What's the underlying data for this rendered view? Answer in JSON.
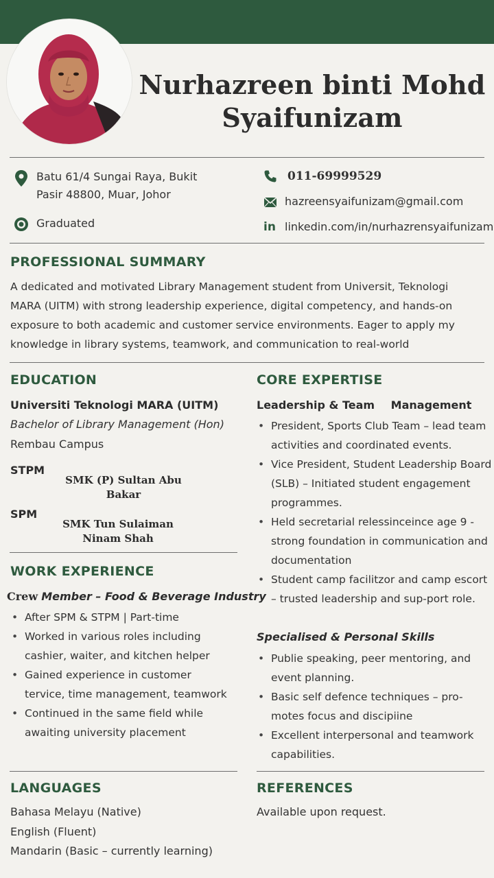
{
  "header": {
    "name_line1": "Nurhazreen binti Mohd",
    "name_line2": "Syaifunizam"
  },
  "contact": {
    "address_line1": "Batu 61/4 Sungai Raya, Bukit",
    "address_line2": "Pasir 48800, Muar, Johor",
    "status": "Graduated",
    "phone": "011-69999529",
    "email": "hazreensyaifunizam@gmail.com",
    "linkedin_label": "in",
    "linkedin": "linkedin.com/in/nurhazrensyaifunizam"
  },
  "summary": {
    "title": "PROFESSIONAL SUMMARY",
    "lines": [
      "A dedicated and motivated Library Management student from Universit, Teknologi",
      "MARA (UITM) with strong leadership experience, digital competency, and hands-on",
      "exposure to both academic and customer service environments. Eager to apply my",
      "knowledge in library systems, teamwork, and communication to real-world"
    ]
  },
  "education": {
    "title": "EDUCATION",
    "university": "Universiti Teknologi MARA (UITM)",
    "degree": "Bachelor of Library Management (Hon)",
    "campus": "Rembau Campus",
    "stpm_label": "STPM",
    "stpm_school_line1": "SMK (P) Sultan Abu",
    "stpm_school_line2": "Bakar",
    "spm_label": "SPM",
    "spm_school_line1": "SMK Tun Sulaiman",
    "spm_school_line2": "Ninam Shah"
  },
  "work": {
    "title": "WORK EXPERIENCE",
    "role_prefix": "Crew",
    "role": "Member – Food & Beverage Industry",
    "items": [
      "After SPM & STPM | Part-time",
      "Worked in various roles including cashier, waiter, and kitchen helper",
      "Gained experience in customer tervice, time management, teamwork",
      "Continued in the same field while awaiting university placement"
    ]
  },
  "expertise": {
    "title": "CORE EXPERTISE",
    "group1_a": "Leadership & Team",
    "group1_b": "Management",
    "group1_items": [
      "President, Sports Club Team – lead team activities and coordinated events.",
      "Vice President, Student Leadership Board (SLB) – Initiated student engagement programmes.",
      "Held secretarial relessinceince age 9 - strong foundation in communication and documentation",
      "Student camp facilitzor and camp escort – trusted leadership and sup-port role."
    ],
    "group2": "Specialised & Personal Skills",
    "group2_items": [
      "Publie speaking, peer mentoring, and event planning.",
      "Basic self defence techniques – pro-motes focus and discipiine",
      "Excellent interpersonal and teamwork capabilities."
    ]
  },
  "languages": {
    "title": "LANGUAGES",
    "items": [
      "Bahasa Melayu (Native)",
      "English (Fluent)",
      "Mandarin (Basic – currently learning)"
    ]
  },
  "references": {
    "title": "REFERENCES",
    "text": "Available upon request."
  },
  "colors": {
    "accent": "#2e5a3e",
    "background": "#f3f2ee",
    "hijab": "#b0294a"
  }
}
